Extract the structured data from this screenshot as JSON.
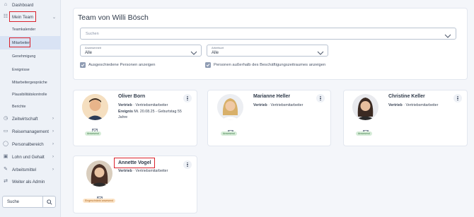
{
  "sidebar": {
    "items": [
      {
        "label": "Dashboard",
        "icon": "dashboard-icon"
      },
      {
        "label": "Mein Team",
        "icon": "team-icon"
      },
      {
        "label": "Zeitwirtschaft",
        "icon": "clock-icon"
      },
      {
        "label": "Reisemanagement",
        "icon": "suitcase-icon"
      },
      {
        "label": "Personalbereich",
        "icon": "user-icon"
      },
      {
        "label": "Lohn und Gehalt",
        "icon": "money-icon"
      },
      {
        "label": "Arbeitsmittel",
        "icon": "tools-icon"
      },
      {
        "label": "Weiter als Admin",
        "icon": "switch-icon"
      }
    ],
    "sub_items": [
      "Teamkalender",
      "Mitarbeiter",
      "Genehmigung",
      "Ereignisse",
      "Mitarbeitergespräche",
      "Plausibilitätskontrolle",
      "Berichte"
    ],
    "search_value": "Suche"
  },
  "team": {
    "title": "Team von Willi Bösch",
    "search_placeholder": "Suchen",
    "filter_anwesenheit": {
      "label": "Anwesenheit",
      "value": "Alle"
    },
    "filter_arbeitsort": {
      "label": "Arbeitsort",
      "value": "Alle"
    },
    "check_ausgeschieden": "Ausgeschiedene Personen anzeigen",
    "check_ausserhalb": "Personen außerhalb des Beschäftigungszeitraumes anzeigen"
  },
  "people": [
    {
      "name": "Oliver Born",
      "dept": "Vertrieb",
      "role": "· Vertriebsmitarbeiter",
      "event_label": "Ereignis",
      "event_text": "Mi. 20.08.25 - Geburtstag 55",
      "event_text2": "Jahre",
      "status": "Anwesend",
      "status_color": "#3b7a45"
    },
    {
      "name": "Marianne Heller",
      "dept": "Vertrieb",
      "role": "· Vertriebsmitarbeiter",
      "status": "Anwesend",
      "status_color": "#3b7a45"
    },
    {
      "name": "Christine Keller",
      "dept": "Vertrieb",
      "role": "· Vertriebsmitarbeiter",
      "status": "Anwesend",
      "status_color": "#3b7a45"
    },
    {
      "name": "Annette Vogel",
      "dept": "Vertrieb",
      "role": "· Vertriebsmitarbeiter",
      "status": "Eingeschränkt anwesend",
      "status_color": "#b0661a"
    }
  ],
  "colors": {
    "highlight": "#d9212c",
    "active_bg": "#d9e3f4"
  }
}
